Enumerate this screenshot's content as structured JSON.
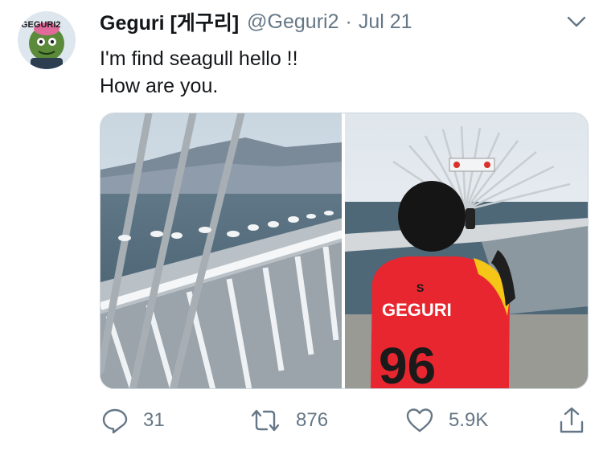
{
  "tweet": {
    "display_name": "Geguri [게구리]",
    "handle": "@Geguri2",
    "separator": "·",
    "date": "Jul 21",
    "text_lines": [
      "I'm find seagull hello !!",
      "How are you."
    ],
    "avatar_text": "GEGURI2"
  },
  "media": {
    "jersey_name": "GEGURI",
    "jersey_number": "96"
  },
  "actions": {
    "reply_count": "31",
    "retweet_count": "876",
    "like_count": "5.9K"
  },
  "colors": {
    "name": "#14171a",
    "muted": "#657786",
    "jersey_red": "#e8262f",
    "jersey_yellow": "#f5c518"
  },
  "icons": [
    "caret-down-icon",
    "reply-icon",
    "retweet-icon",
    "like-icon",
    "share-icon"
  ]
}
